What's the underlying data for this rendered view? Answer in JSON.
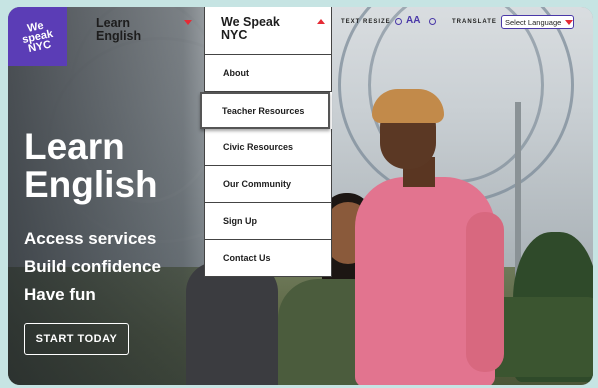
{
  "logo": {
    "text": "We\nspeak\nNYC"
  },
  "nav": {
    "learn_english": "Learn\nEnglish",
    "we_speak_nyc": "We Speak\nNYC",
    "menu_items": [
      "About",
      "Teacher Resources",
      "Civic Resources",
      "Our Community",
      "Sign Up",
      "Contact Us"
    ],
    "active_item": "Teacher Resources"
  },
  "toolbar": {
    "text_resize_label": "TEXT RESIZE",
    "resize_letters": "AA",
    "translate_label": "TRANSLATE",
    "language_select": "Select Language"
  },
  "hero": {
    "title": "Learn\nEnglish",
    "lines": [
      "Access services",
      "Build confidence",
      "Have fun"
    ],
    "cta": "START TODAY"
  },
  "colors": {
    "brand_purple": "#5b3db6",
    "accent_red": "#e52b35",
    "outline_purple": "#4a38a8"
  }
}
